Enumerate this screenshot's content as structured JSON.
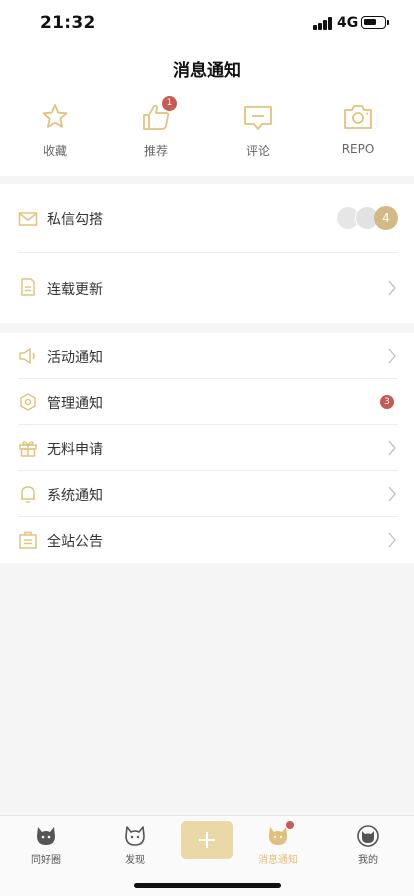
{
  "status_bar": {
    "time": "21:32",
    "network": "4G"
  },
  "header": {
    "title": "消息通知"
  },
  "quick_actions": [
    {
      "label": "收藏",
      "icon": "star-icon"
    },
    {
      "label": "推荐",
      "icon": "thumbs-up-icon",
      "badge": "1"
    },
    {
      "label": "评论",
      "icon": "comment-icon"
    },
    {
      "label": "REPO",
      "icon": "camera-icon"
    }
  ],
  "section1": [
    {
      "label": "私信勾搭",
      "icon": "mail-icon",
      "count": "4"
    },
    {
      "label": "连载更新",
      "icon": "document-icon"
    }
  ],
  "section2": [
    {
      "label": "活动通知",
      "icon": "speaker-icon"
    },
    {
      "label": "管理通知",
      "icon": "hexagon-icon",
      "badge": "3"
    },
    {
      "label": "无料申请",
      "icon": "gift-icon"
    },
    {
      "label": "系统通知",
      "icon": "bell-icon"
    },
    {
      "label": "全站公告",
      "icon": "announcement-icon"
    }
  ],
  "tabbar": [
    {
      "label": "同好圈",
      "icon": "circle-cat-icon"
    },
    {
      "label": "发现",
      "icon": "discover-cat-icon"
    },
    {
      "label": "消息通知",
      "icon": "message-cat-icon",
      "active": true
    },
    {
      "label": "我的",
      "icon": "profile-cat-icon"
    }
  ],
  "colors": {
    "accent": "#e0c07a",
    "icon_gold": "#e3c27d",
    "badge_red": "#c75a51",
    "plus_bg": "#ead8a6"
  }
}
